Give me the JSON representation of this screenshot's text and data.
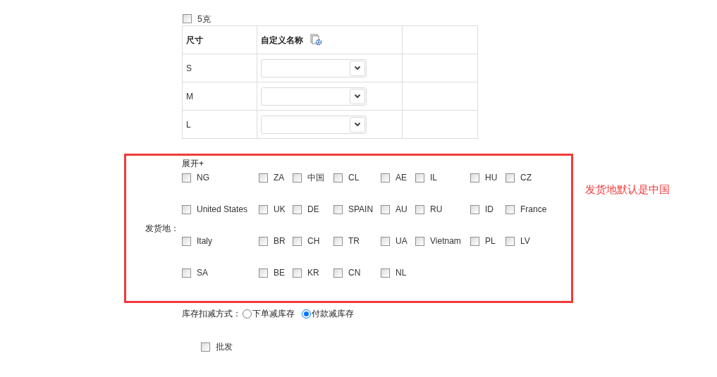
{
  "weight_option": {
    "label": "5克",
    "checked": false
  },
  "size_table": {
    "columns": [
      "尺寸",
      "自定义名称",
      ""
    ],
    "rows": [
      {
        "size": "S"
      },
      {
        "size": "M"
      },
      {
        "size": "L"
      }
    ]
  },
  "ship_from": {
    "label": "发货地：",
    "expand_link": "展开+",
    "note": "发货地默认是中国",
    "options": [
      {
        "label": "NG",
        "checked": false
      },
      {
        "label": "ZA",
        "checked": false
      },
      {
        "label": "中国",
        "checked": false
      },
      {
        "label": "CL",
        "checked": false
      },
      {
        "label": "AE",
        "checked": false
      },
      {
        "label": "IL",
        "checked": false
      },
      {
        "label": "HU",
        "checked": false
      },
      {
        "label": "CZ",
        "checked": false
      },
      {
        "label": "United States",
        "checked": false
      },
      {
        "label": "UK",
        "checked": false
      },
      {
        "label": "DE",
        "checked": false
      },
      {
        "label": "SPAIN",
        "checked": false
      },
      {
        "label": "AU",
        "checked": false
      },
      {
        "label": "RU",
        "checked": false
      },
      {
        "label": "ID",
        "checked": false
      },
      {
        "label": "France",
        "checked": false
      },
      {
        "label": "Italy",
        "checked": false
      },
      {
        "label": "BR",
        "checked": false
      },
      {
        "label": "CH",
        "checked": false
      },
      {
        "label": "TR",
        "checked": false
      },
      {
        "label": "UA",
        "checked": false
      },
      {
        "label": "Vietnam",
        "checked": false
      },
      {
        "label": "PL",
        "checked": false
      },
      {
        "label": "LV",
        "checked": false
      },
      {
        "label": "SA",
        "checked": false
      },
      {
        "label": "BE",
        "checked": false
      },
      {
        "label": "KR",
        "checked": false
      },
      {
        "label": "CN",
        "checked": false
      },
      {
        "label": "NL",
        "checked": false
      }
    ]
  },
  "stock_deduction": {
    "label": "库存扣减方式：",
    "options": [
      {
        "label": "下单减库存",
        "selected": false
      },
      {
        "label": "付款减库存",
        "selected": true
      }
    ]
  },
  "wholesale": {
    "label": "批发",
    "checked": false
  }
}
